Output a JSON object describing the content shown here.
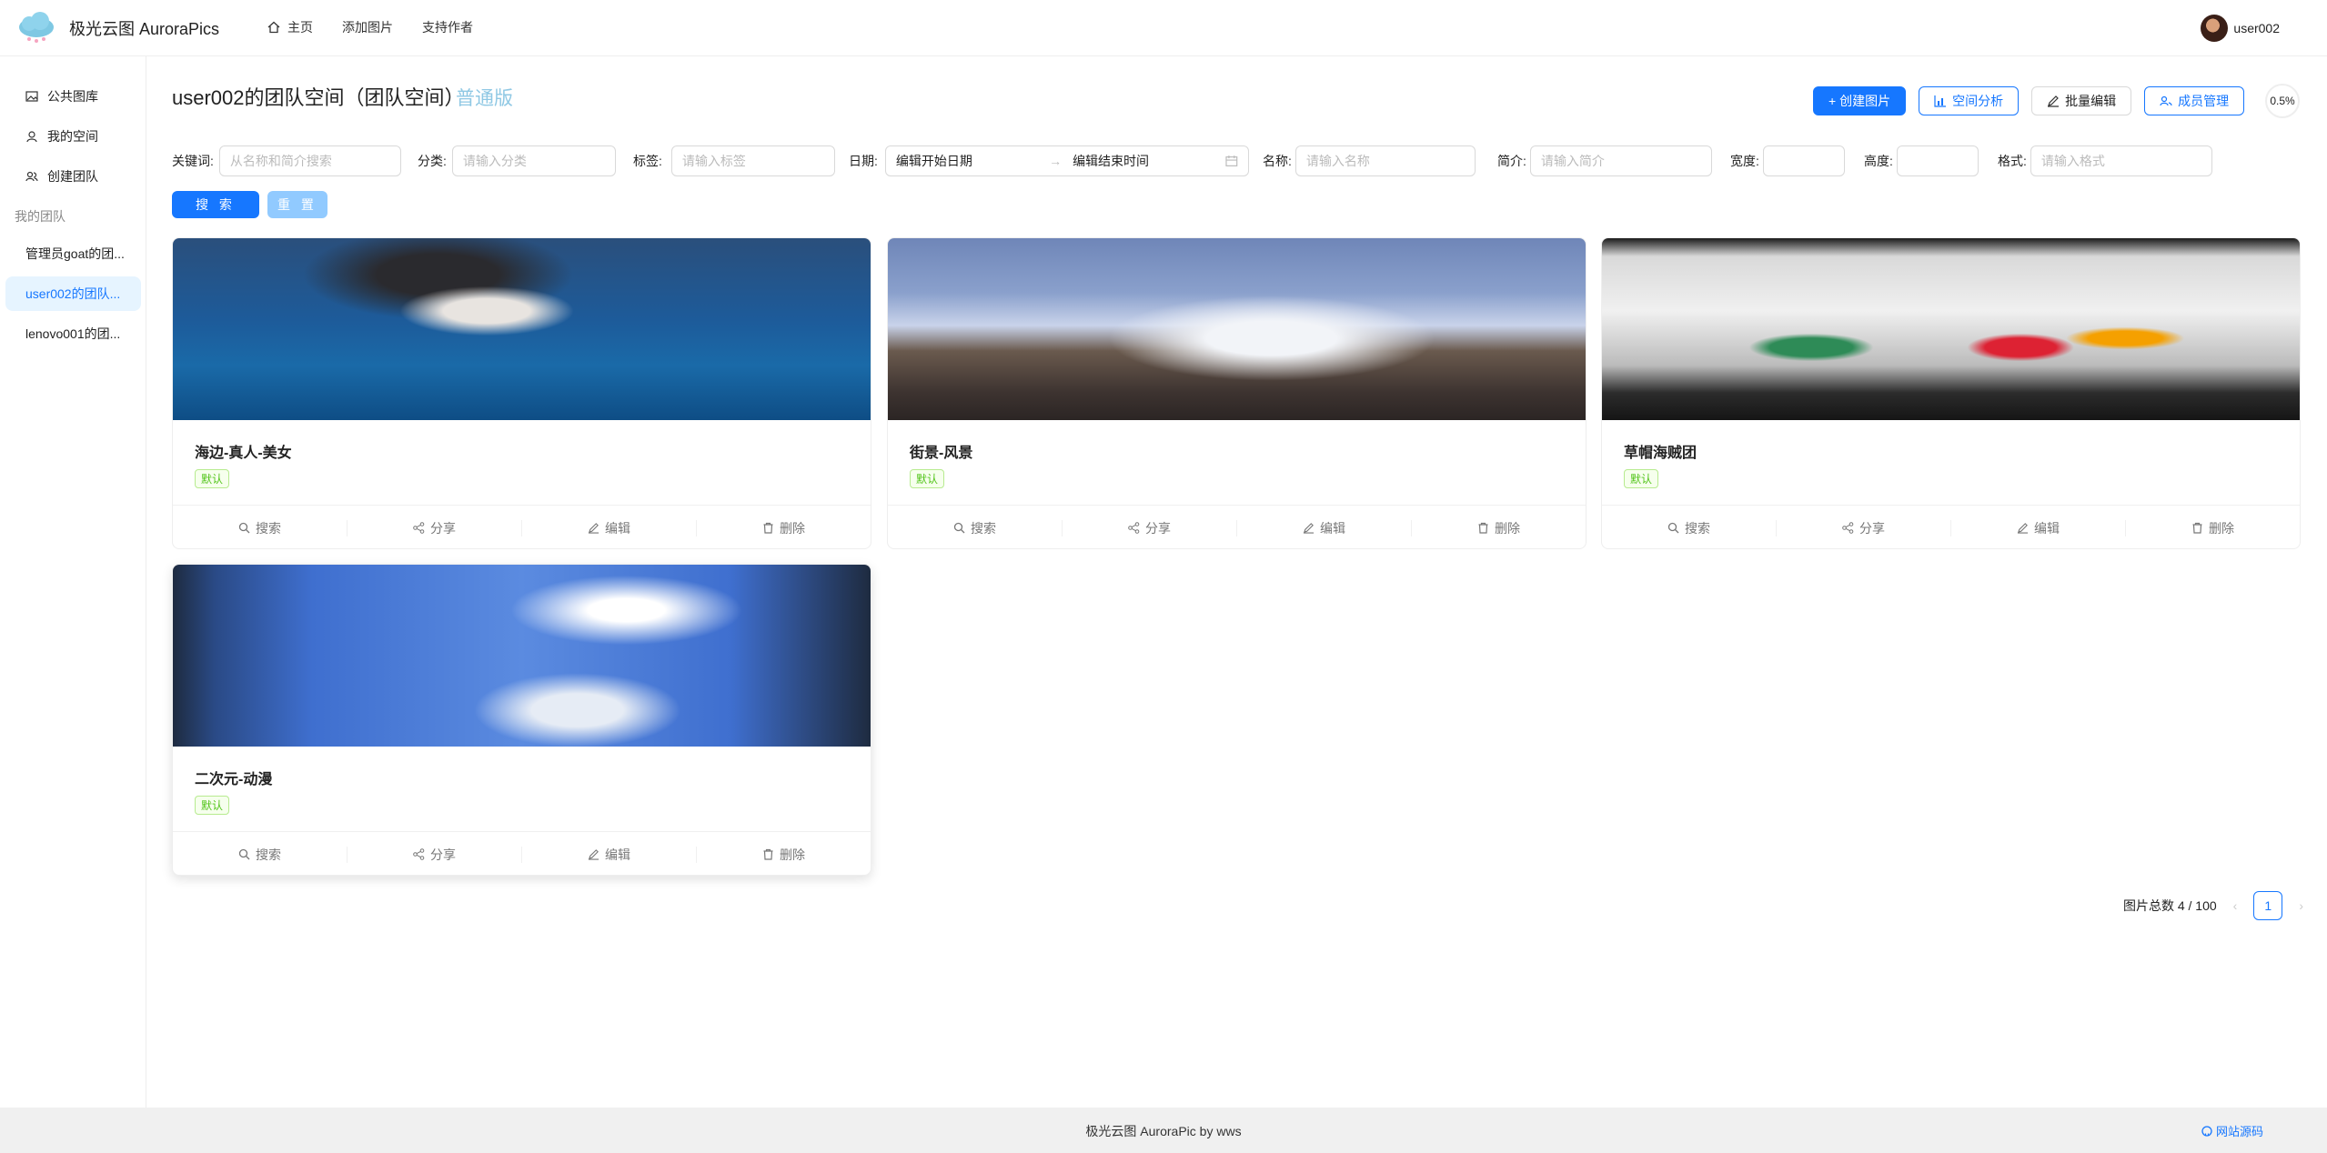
{
  "app": {
    "title": "极光云图 AuroraPics"
  },
  "topnav": [
    {
      "label": "主页",
      "icon": "home-icon"
    },
    {
      "label": "添加图片"
    },
    {
      "label": "支持作者"
    }
  ],
  "user": {
    "name": "user002"
  },
  "sidebar": {
    "items": [
      {
        "label": "公共图库",
        "icon": "picture-icon"
      },
      {
        "label": "我的空间",
        "icon": "user-icon"
      },
      {
        "label": "创建团队",
        "icon": "team-icon"
      }
    ],
    "group_label": "我的团队",
    "teams": [
      {
        "label": "管理员goat的团..."
      },
      {
        "label": "user002的团队..."
      },
      {
        "label": "lenovo001的团..."
      }
    ]
  },
  "space": {
    "title": "user002的团队空间（团队空间）",
    "level": "普通版",
    "usage": "0.5%"
  },
  "actions": {
    "create": "+ 创建图片",
    "analyze": "空间分析",
    "batch": "批量编辑",
    "members": "成员管理"
  },
  "filters": {
    "keyword_label": "关键词:",
    "keyword_placeholder": "从名称和简介搜索",
    "category_label": "分类:",
    "category_placeholder": "请输入分类",
    "tag_label": "标签:",
    "tag_placeholder": "请输入标签",
    "date_label": "日期:",
    "date_start_placeholder": "编辑开始日期",
    "date_end_placeholder": "编辑结束时间",
    "name_label": "名称:",
    "name_placeholder": "请输入名称",
    "intro_label": "简介:",
    "intro_placeholder": "请输入简介",
    "width_label": "宽度:",
    "height_label": "高度:",
    "format_label": "格式:",
    "format_placeholder": "请输入格式",
    "search": "搜 索",
    "reset": "重 置"
  },
  "cards": [
    {
      "name": "海边-真人-美女",
      "tag": "默认"
    },
    {
      "name": "街景-风景",
      "tag": "默认"
    },
    {
      "name": "草帽海贼团",
      "tag": "默认"
    },
    {
      "name": "二次元-动漫",
      "tag": "默认"
    }
  ],
  "card_actions": {
    "search": "搜索",
    "share": "分享",
    "edit": "编辑",
    "delete": "删除"
  },
  "pagination": {
    "total_text": "图片总数 4 / 100",
    "current": "1"
  },
  "footer": {
    "text": "极光云图 AuroraPic by wws",
    "link": "网站源码"
  },
  "colors": {
    "primary": "#1677ff",
    "active_bg": "#e6f4ff",
    "tag_green": "#52c41a",
    "level": "#8fc8e4"
  }
}
